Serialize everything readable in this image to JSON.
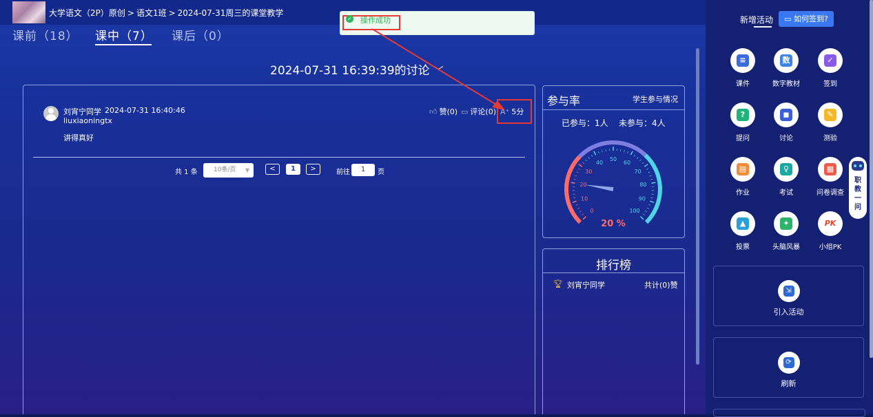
{
  "breadcrumb": {
    "course": "大学语文（2P）原创",
    "class": "语文1班",
    "session": "2024-07-31周三的课堂教学",
    "separator": ">"
  },
  "tabs": [
    {
      "label": "课前（18）"
    },
    {
      "label": "课中（7）"
    },
    {
      "label": "课后（0）"
    }
  ],
  "toast": {
    "text": "操作成功"
  },
  "discussion": {
    "title": "2024-07-31 16:39:39的讨论",
    "chevron": "﹀"
  },
  "post": {
    "name": "刘宵宁同学",
    "time": "2024-07-31 16:40:46",
    "username": "liuxiaoningtx",
    "content": "讲得真好",
    "like_label": "赞(0)",
    "comment_label": "评论(0)",
    "score_label": "5分"
  },
  "pagination": {
    "total": "共 1 条",
    "page_size": "10条/页",
    "prev": "<",
    "current": "1",
    "next": ">",
    "goto_label": "前往",
    "goto_value": "1",
    "page_label": "页"
  },
  "participation": {
    "title": "参与率",
    "detail_link": "学生参与情况",
    "joined": "已参与：1人",
    "not_joined": "未参与：4人",
    "percent": 20,
    "percent_label": "20 %",
    "ticks": [
      "0",
      "10",
      "20",
      "30",
      "40",
      "50",
      "60",
      "70",
      "80",
      "90",
      "100"
    ],
    "colors": {
      "low": "#ff6b6b",
      "high": "#4fd4e6"
    }
  },
  "ranking": {
    "title": "排行榜",
    "items": [
      {
        "name": "刘宵宁同学",
        "likes": "共计(0)赞"
      }
    ]
  },
  "sidebar": {
    "heading": "新增活动",
    "howto": "如何签到?",
    "activities": [
      {
        "label": "课件",
        "icon": "courseware-icon",
        "color": "#3d6bd9",
        "glyph": "≡"
      },
      {
        "label": "数字教材",
        "icon": "digital-textbook-icon",
        "color": "#3a86e8",
        "glyph": "数"
      },
      {
        "label": "签到",
        "icon": "signin-icon",
        "color": "#8a5ae8",
        "glyph": "✓"
      },
      {
        "label": "提问",
        "icon": "question-icon",
        "color": "#1fb27a",
        "glyph": "?"
      },
      {
        "label": "讨论",
        "icon": "discussion-icon",
        "color": "#3b5fd8",
        "glyph": "◼"
      },
      {
        "label": "测验",
        "icon": "quiz-icon",
        "color": "#f5b829",
        "glyph": "✎"
      },
      {
        "label": "作业",
        "icon": "homework-icon",
        "color": "#f08c3a",
        "glyph": "▤"
      },
      {
        "label": "考试",
        "icon": "exam-icon",
        "color": "#1aa9a0",
        "glyph": "♀"
      },
      {
        "label": "问卷调查",
        "icon": "survey-icon",
        "color": "#ec5a4a",
        "glyph": "▦"
      },
      {
        "label": "投票",
        "icon": "vote-icon",
        "color": "#2aa0d8",
        "glyph": "▲"
      },
      {
        "label": "头脑风暴",
        "icon": "brainstorm-icon",
        "color": "#2db36a",
        "glyph": "✦"
      },
      {
        "label": "小组PK",
        "icon": "group-pk-icon",
        "color": "#ffffff",
        "glyph": "PK"
      }
    ],
    "import_label": "引入活动",
    "refresh_label": "刷新",
    "assistant_label": "职教一问"
  }
}
